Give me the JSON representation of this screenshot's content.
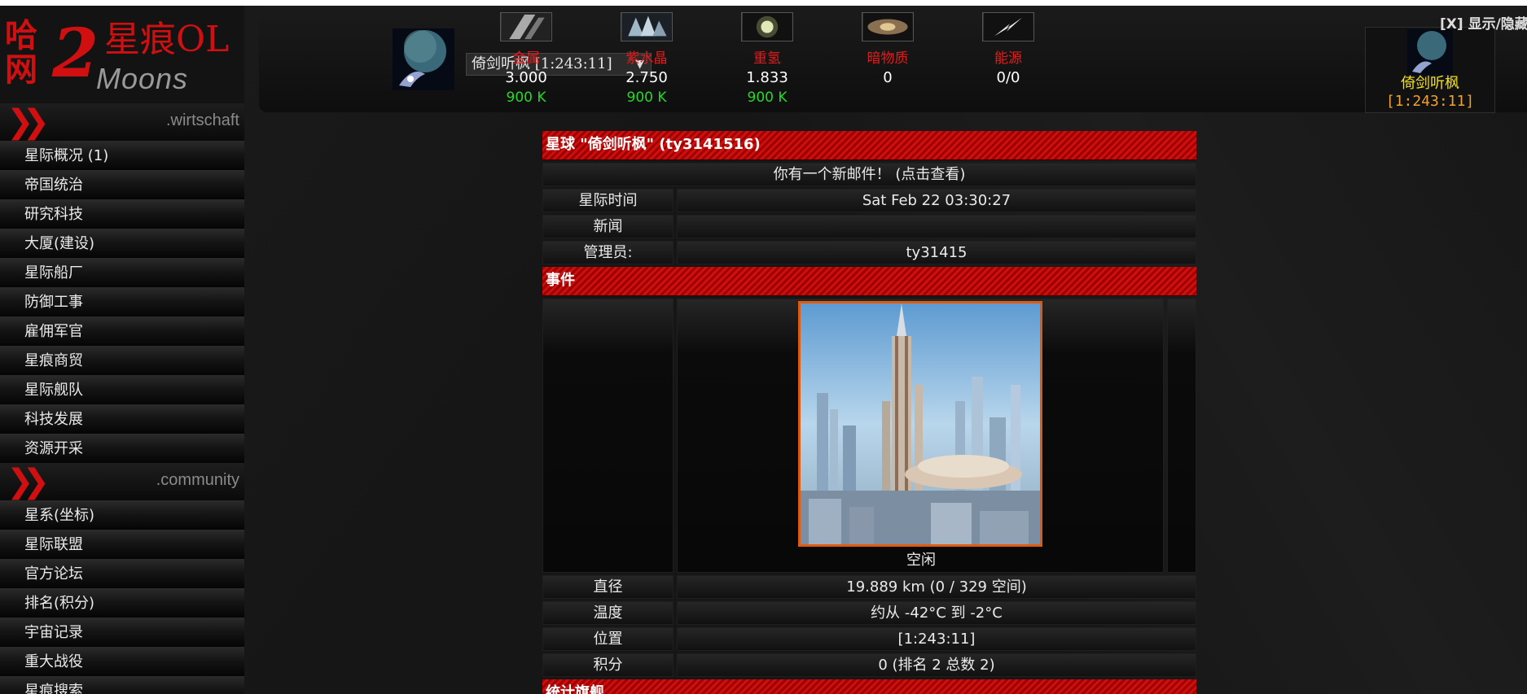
{
  "logo": {
    "title": "星痕OL",
    "sub": "Moons",
    "fire_text": "哈\n网",
    "number": "2"
  },
  "sidebar": {
    "sections": [
      {
        "label": ".wirtschaft",
        "items": [
          "星际概况 (1)",
          "帝国统治",
          "研究科技",
          "大厦(建设)",
          "星际船厂",
          "防御工事",
          "雇佣军官",
          "星痕商贸",
          "星际舰队",
          "科技发展",
          "资源开采"
        ]
      },
      {
        "label": ".community",
        "items": [
          "星系(坐标)",
          "星际联盟",
          "官方论坛",
          "排名(积分)",
          "宇宙记录",
          "重大战役",
          "星痕搜索"
        ]
      }
    ]
  },
  "topbar": {
    "planet_select": "倚剑听枫 [1:243:11]",
    "toggle_link": "[X] 显示/隐藏",
    "resources": [
      {
        "name": "金属",
        "value": "3.000",
        "production": "900 K",
        "icon": "metal-icon"
      },
      {
        "name": "紫水晶",
        "value": "2.750",
        "production": "900 K",
        "icon": "crystal-icon"
      },
      {
        "name": "重氢",
        "value": "1.833",
        "production": "900 K",
        "icon": "deuterium-icon"
      },
      {
        "name": "暗物质",
        "value": "0",
        "production": "",
        "icon": "darkmatter-icon"
      },
      {
        "name": "能源",
        "value": "0/0",
        "production": "",
        "icon": "energy-icon"
      }
    ],
    "current_planet": {
      "name": "倚剑听枫",
      "coords": "[1:243:11]"
    }
  },
  "overview": {
    "title": "星球 \"倚剑听枫\" (ty3141516)",
    "new_mail": "你有一个新邮件！ (点击查看)",
    "time_label": "星际时间",
    "time_value": "Sat Feb 22 03:30:27",
    "news_label": "新闻",
    "news_value": "",
    "admin_label": "管理员:",
    "admin_value": "ty31415",
    "events_title": "事件",
    "planet_status": "空闲",
    "diameter_label": "直径",
    "diameter_value": "19.889 km (0 / 329 空间)",
    "temp_label": "温度",
    "temp_value": "约从 -42°C 到 -2°C",
    "position_label": "位置",
    "position_value": "[1:243:11]",
    "points_label": "积分",
    "points_value": "0 (排名 2 总数 2)",
    "stats_title": "统计旗舰"
  }
}
